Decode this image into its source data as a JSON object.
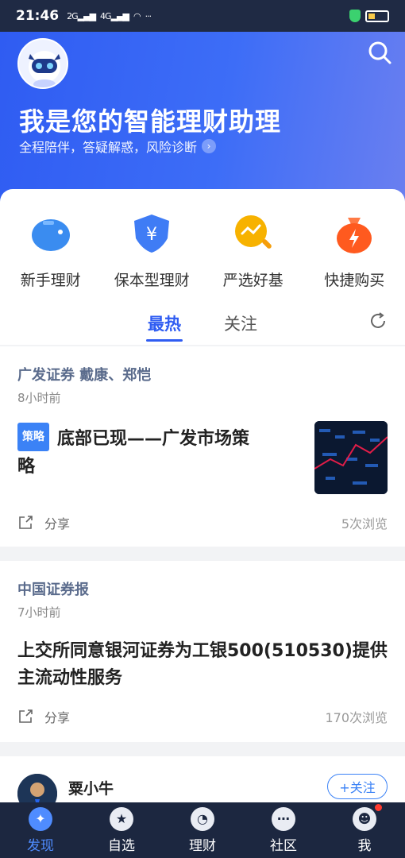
{
  "status_bar": {
    "time": "21:46",
    "sig1": "2G",
    "sig2": "4G",
    "more": "···"
  },
  "hero": {
    "title": "我是您的智能理财助理",
    "subtitle": "全程陪伴，答疑解惑，风险诊断",
    "icons": {
      "avatar": "robot-avatar-icon",
      "search": "search-icon"
    }
  },
  "quick_entries": [
    {
      "label": "新手理财",
      "icon": "piggy-bank-icon",
      "color": "#3a8cf0"
    },
    {
      "label": "保本型理财",
      "icon": "shield-yuan-icon",
      "color": "#3f7cf5"
    },
    {
      "label": "严选好基",
      "icon": "magnifier-trend-icon",
      "color": "#f7b200"
    },
    {
      "label": "快捷购买",
      "icon": "money-bag-icon",
      "color": "#ff5a1f"
    }
  ],
  "tabs": [
    {
      "label": "最热",
      "active": true
    },
    {
      "label": "关注",
      "active": false
    }
  ],
  "feed": [
    {
      "author": "广发证券 戴康、郑恺",
      "time": "8小时前",
      "tag": "策略",
      "title": "底部已现——广发市场策略",
      "share": "分享",
      "views": "5次浏览"
    },
    {
      "author": "中国证券报",
      "time": "7小时前",
      "title": "上交所同意银河证券为工银500(510530)提供主流动性服务",
      "share": "分享",
      "views": "170次浏览"
    },
    {
      "author": "粟小牛",
      "follow": "+关注"
    }
  ],
  "tabbar": [
    {
      "label": "发现",
      "icon": "discover-icon",
      "active": true
    },
    {
      "label": "自选",
      "icon": "star-icon",
      "active": false
    },
    {
      "label": "理财",
      "icon": "wealth-icon",
      "active": false
    },
    {
      "label": "社区",
      "icon": "chat-icon",
      "active": false
    },
    {
      "label": "我",
      "icon": "profile-icon",
      "active": false,
      "badge": true
    }
  ],
  "colors": {
    "accent": "#2f5cf2",
    "tabbar_bg": "#1c2740",
    "badge": "#ff3b30"
  }
}
